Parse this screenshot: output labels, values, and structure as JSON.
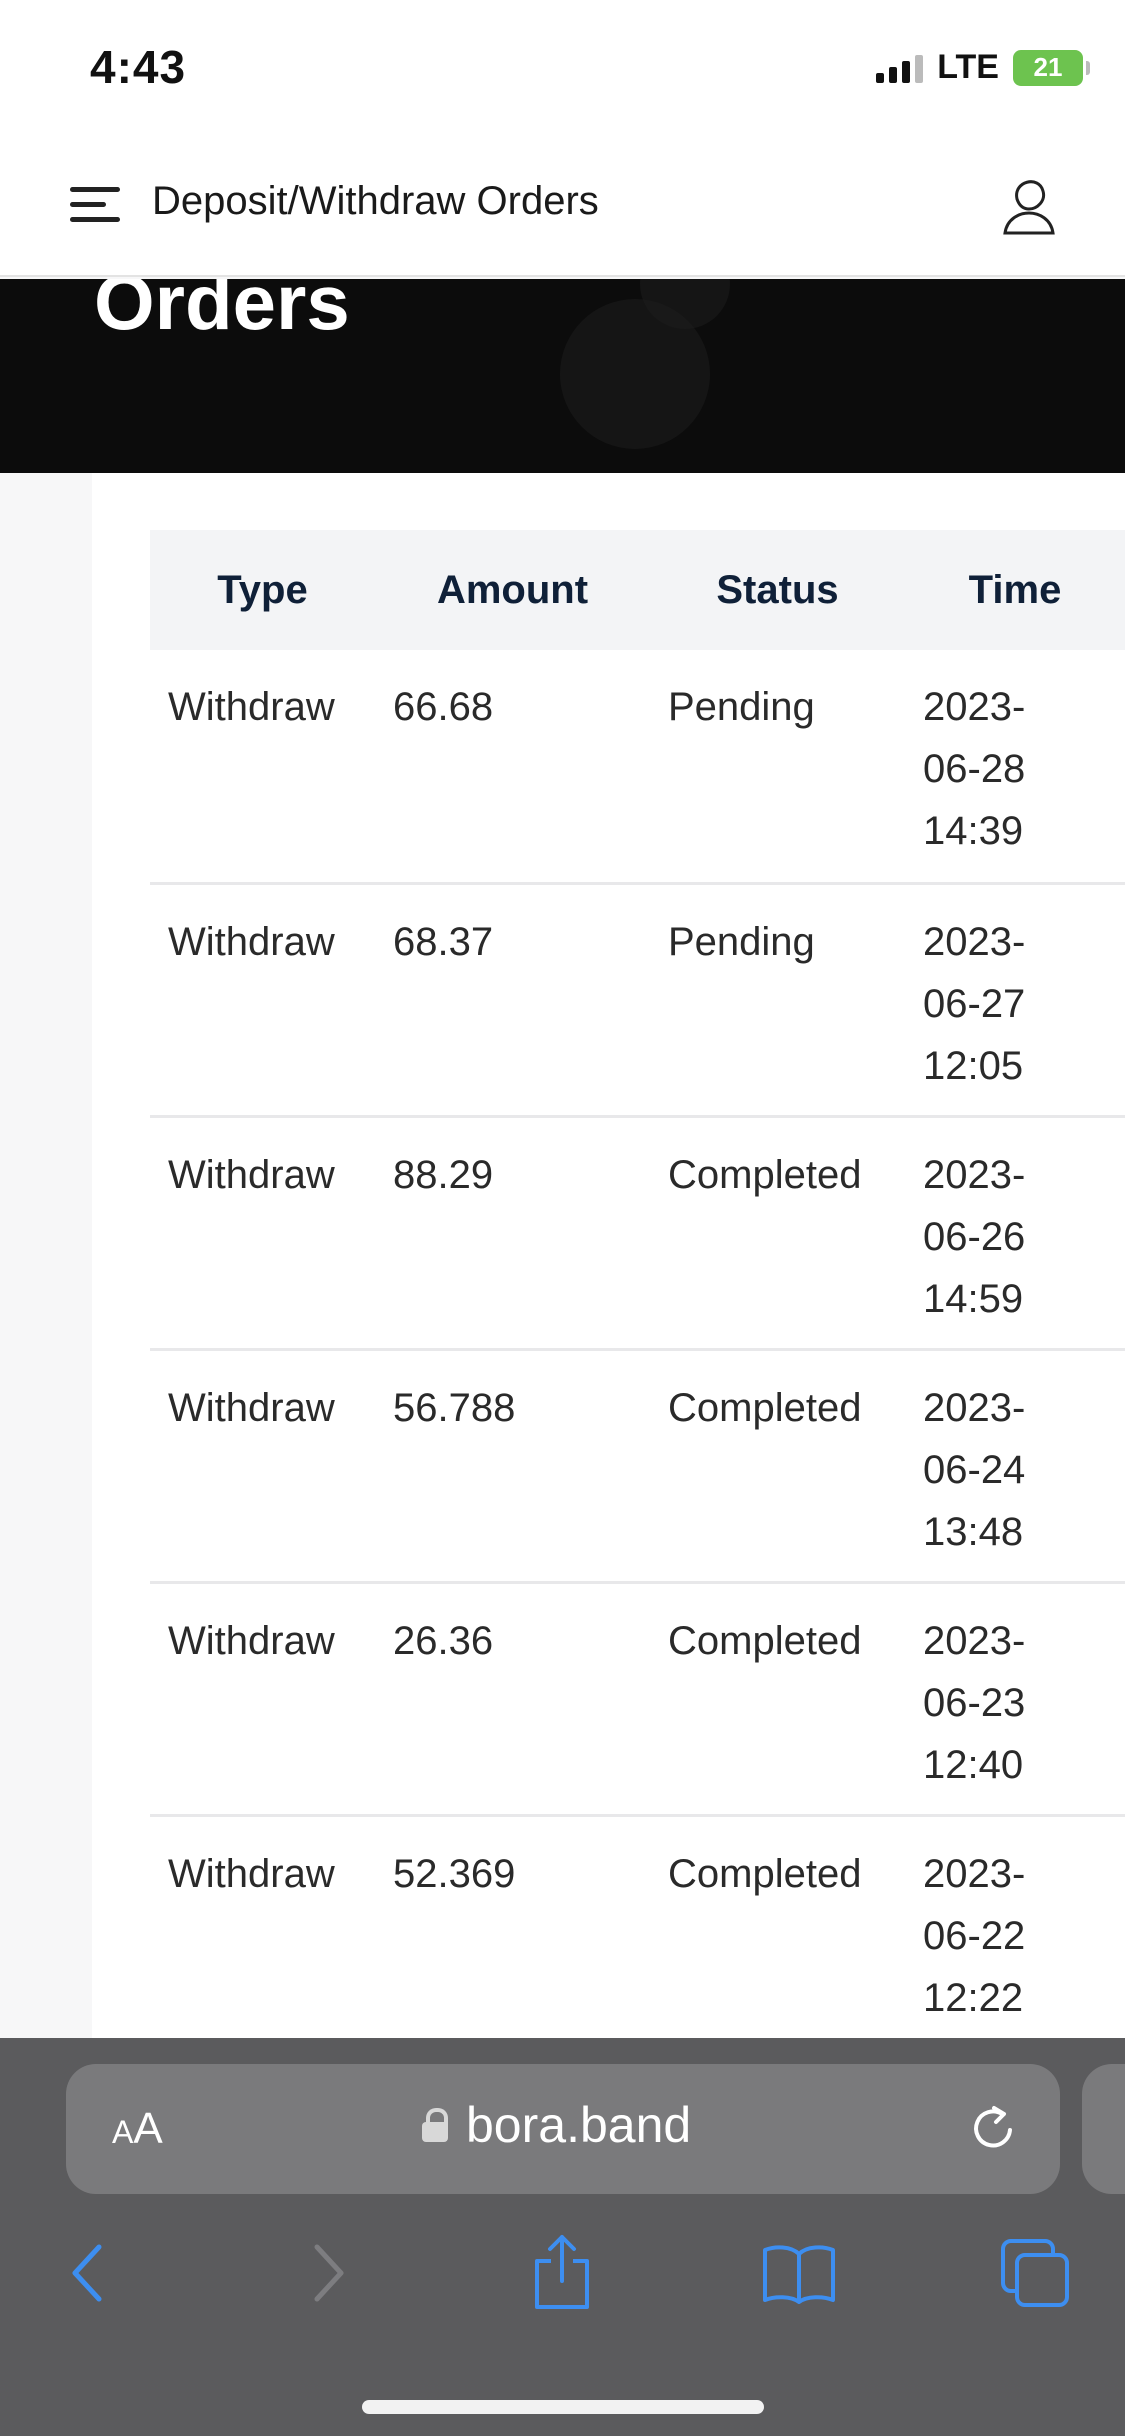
{
  "status_bar": {
    "time": "4:43",
    "carrier": "LTE",
    "battery": "21"
  },
  "header": {
    "title": "Deposit/Withdraw Orders",
    "menu_icon": "hamburger-menu-icon",
    "user_icon": "user-profile-icon"
  },
  "hero": {
    "title": "Orders"
  },
  "table": {
    "columns": [
      "Type",
      "Amount",
      "Status",
      "Time"
    ],
    "rows": [
      {
        "type": "Withdraw",
        "amount": "66.68",
        "status": "Pending",
        "date": "2023-",
        "date2": "06-28",
        "clock": "14:39"
      },
      {
        "type": "Withdraw",
        "amount": "68.37",
        "status": "Pending",
        "date": "2023-",
        "date2": "06-27",
        "clock": "12:05"
      },
      {
        "type": "Withdraw",
        "amount": "88.29",
        "status": "Completed",
        "date": "2023-",
        "date2": "06-26",
        "clock": "14:59"
      },
      {
        "type": "Withdraw",
        "amount": "56.788",
        "status": "Completed",
        "date": "2023-",
        "date2": "06-24",
        "clock": "13:48"
      },
      {
        "type": "Withdraw",
        "amount": "26.36",
        "status": "Completed",
        "date": "2023-",
        "date2": "06-23",
        "clock": "12:40"
      },
      {
        "type": "Withdraw",
        "amount": "52.369",
        "status": "Completed",
        "date": "2023-",
        "date2": "06-22",
        "clock": "12:22"
      }
    ]
  },
  "browser": {
    "aa_label_small": "A",
    "aa_label_large": "A",
    "url": "bora.band",
    "accent_color": "#3d8ef0",
    "bar_color": "#5b5b5d"
  }
}
